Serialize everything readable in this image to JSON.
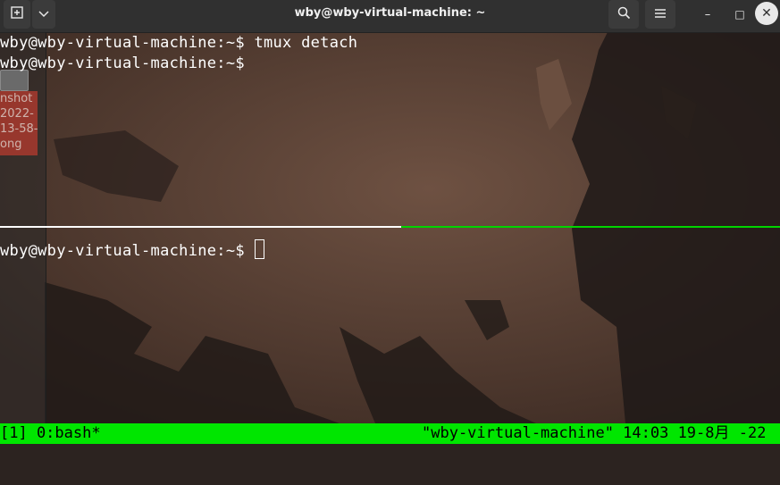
{
  "window": {
    "title": "wby@wby-virtual-machine: ~",
    "new_tab_icon": "new-tab-icon",
    "menu_icon": "chevron-down-icon",
    "search_icon": "search-icon",
    "hamburger_icon": "hamburger-menu-icon",
    "minimize_glyph": "–",
    "maximize_glyph": "□",
    "close_glyph": "✕"
  },
  "desktop": {
    "file_label_lines": [
      "nshot",
      "2022-",
      "13-58-",
      "ong"
    ]
  },
  "terminal": {
    "top_pane": [
      "wby@wby-virtual-machine:~$ tmux detach",
      "wby@wby-virtual-machine:~$"
    ],
    "bottom_pane": {
      "prompt": "wby@wby-virtual-machine:~$ "
    }
  },
  "status_bar": {
    "left": "[1] 0:bash*",
    "right": "\"wby-virtual-machine\" 14:03 19-8月 -22",
    "color": "#00e600"
  }
}
